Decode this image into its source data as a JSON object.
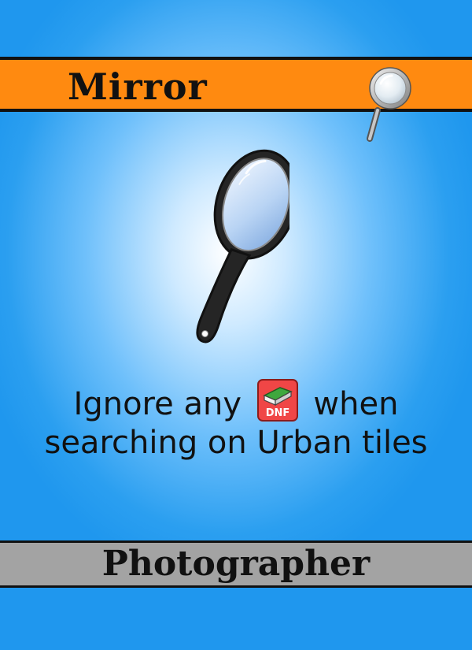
{
  "card": {
    "title": "Mirror",
    "ability": {
      "before_icon": "Ignore any",
      "icon_label": "DNF",
      "after_icon": "when searching on Urban tiles"
    },
    "role": "Photographer"
  },
  "icons": {
    "title_icon": "magnifying-glass-icon",
    "main_art": "hand-mirror-illustration",
    "inline_token": "dnf-token-icon"
  },
  "colors": {
    "title_bar": "#ff8a10",
    "role_bar": "#a3a3a3",
    "background_edge": "#1f97ee",
    "token_red": "#f04646",
    "token_green": "#3ea83e"
  }
}
